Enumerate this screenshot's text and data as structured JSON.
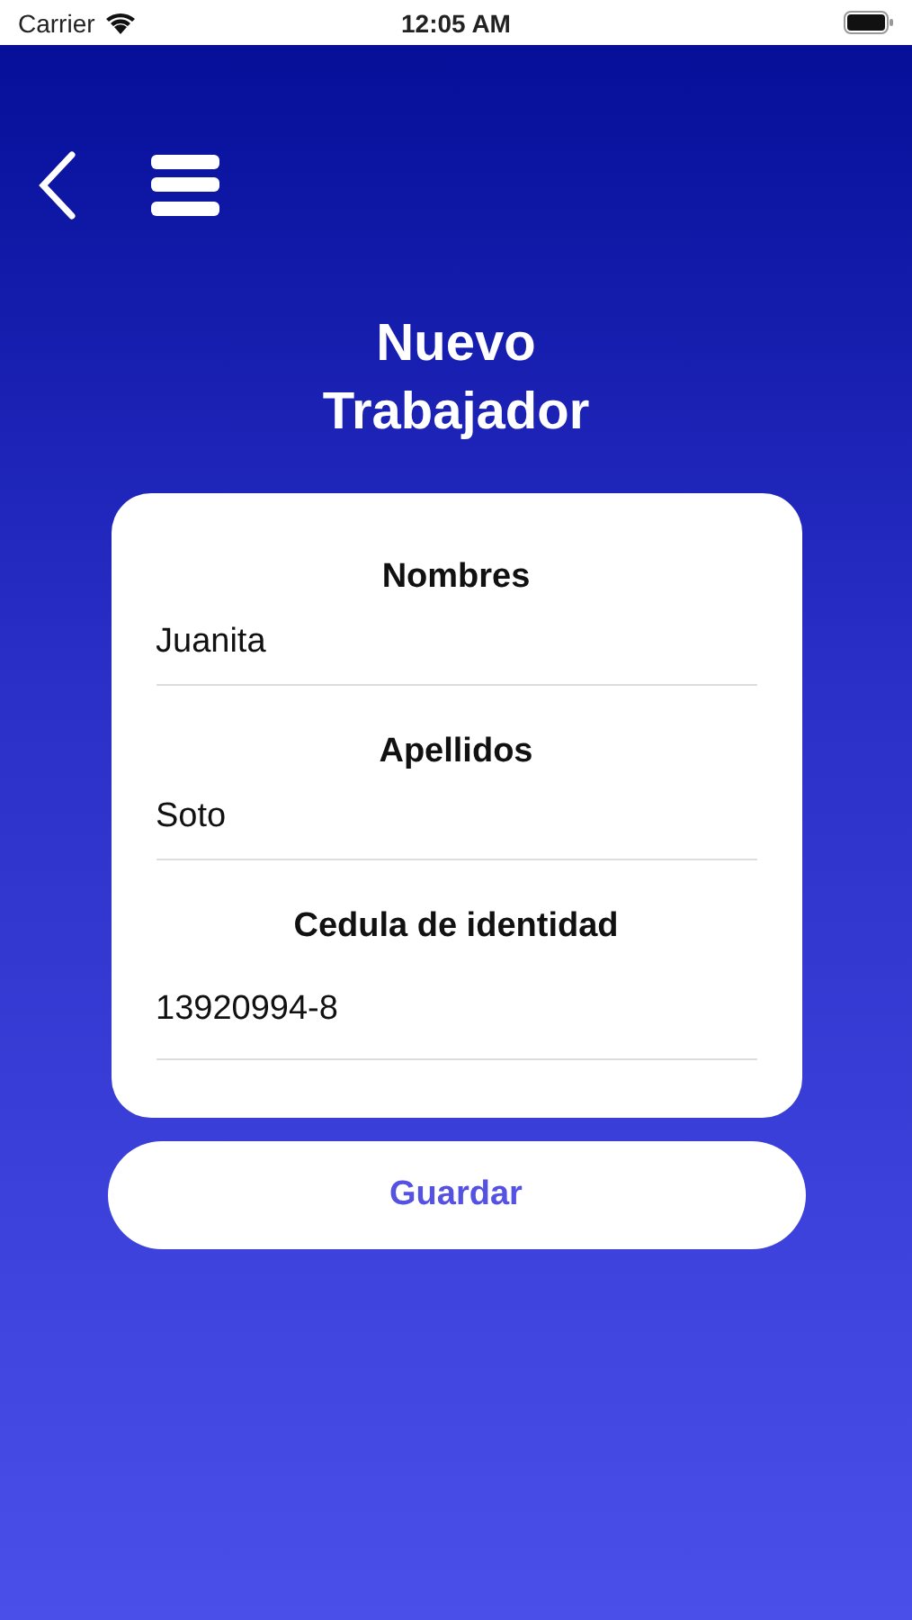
{
  "status_bar": {
    "carrier": "Carrier",
    "time": "12:05 AM"
  },
  "title": "Nuevo\nTrabajador",
  "fields": [
    {
      "label": "Nombres",
      "value": "Juanita"
    },
    {
      "label": "Apellidos",
      "value": "Soto"
    },
    {
      "label": "Cedula de identidad",
      "value": "13920994-8"
    }
  ],
  "save_button": "Guardar"
}
